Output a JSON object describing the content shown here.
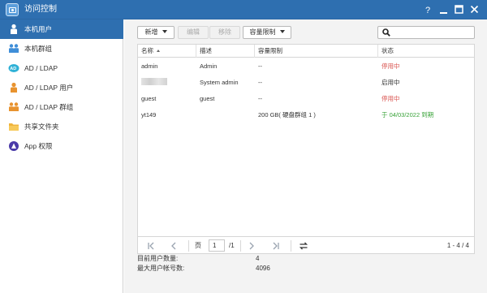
{
  "window": {
    "title": "访问控制",
    "controls": [
      "help-icon",
      "minimize-icon",
      "maximize-icon",
      "close-icon"
    ]
  },
  "sidebar": {
    "items": [
      {
        "label": "本机用户",
        "icon": "user-icon",
        "active": true
      },
      {
        "label": "本机群组",
        "icon": "group-icon",
        "active": false
      },
      {
        "label": "AD / LDAP",
        "icon": "ad-ldap-icon",
        "active": false
      },
      {
        "label": "AD / LDAP 用户",
        "icon": "ad-user-icon",
        "active": false
      },
      {
        "label": "AD / LDAP 群组",
        "icon": "ad-group-icon",
        "active": false
      },
      {
        "label": "共享文件夹",
        "icon": "folder-icon",
        "active": false
      },
      {
        "label": "App 权限",
        "icon": "app-permission-icon",
        "active": false
      }
    ]
  },
  "toolbar": {
    "new_label": "新增",
    "edit_label": "编辑",
    "remove_label": "移除",
    "quota_label": "容量限制",
    "search_placeholder": ""
  },
  "table": {
    "columns": [
      "名称",
      "描述",
      "容量限制",
      "状态"
    ],
    "rows": [
      {
        "name": "admin",
        "description": "Admin",
        "quota": "--",
        "status": "停用中",
        "status_color": "#d9534f"
      },
      {
        "name": "",
        "name_obscured": true,
        "description": "System admin",
        "quota": "--",
        "status": "启用中",
        "status_color": "#333333"
      },
      {
        "name": "guest",
        "description": "guest",
        "quota": "--",
        "status": "停用中",
        "status_color": "#d9534f"
      },
      {
        "name": "yt149",
        "description": "",
        "quota": "200 GB( 硬盘群组 1 )",
        "status": "于 04/03/2022 到期",
        "status_color": "#3aa33a"
      }
    ]
  },
  "pager": {
    "page_label": "页",
    "page_value": "1",
    "total_pages": "/1",
    "range": "1 - 4 / 4"
  },
  "stats": {
    "current_users_label": "目前用户数量:",
    "current_users_value": "4",
    "max_accounts_label": "最大用户帐号数:",
    "max_accounts_value": "4096"
  },
  "colors": {
    "titlebar": "#2e6fb0",
    "active_nav": "#2e6fb0",
    "status_disabled": "#d9534f",
    "status_expiry": "#3aa33a"
  }
}
